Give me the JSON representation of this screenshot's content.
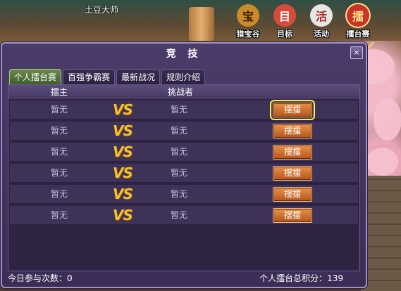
{
  "player": {
    "name": "土豆大师"
  },
  "top_icons": [
    {
      "label": "猎宝谷",
      "icon": "treasure-icon",
      "glyph": "宝",
      "color": "#c98a2a"
    },
    {
      "label": "目标",
      "icon": "target-character-icon",
      "glyph": "目",
      "color": "#d84a3a"
    },
    {
      "label": "活动",
      "icon": "event-icon",
      "glyph": "活",
      "color": "#e6e6e6"
    },
    {
      "label": "擂台赛",
      "icon": "arena-icon",
      "glyph": "擂",
      "color": "#c8332a"
    }
  ],
  "dialog": {
    "title": "竞 技",
    "close": "×",
    "tabs": [
      "个人擂台赛",
      "百强争霸赛",
      "最新战况",
      "规则介绍"
    ],
    "active_tab": 0,
    "columns": {
      "host": "擂主",
      "challenger": "挑战者"
    },
    "rows": [
      {
        "host": "暂无",
        "vs": "VS",
        "challenger": "暂无",
        "action": "摆擂"
      },
      {
        "host": "暂无",
        "vs": "VS",
        "challenger": "暂无",
        "action": "摆擂"
      },
      {
        "host": "暂无",
        "vs": "VS",
        "challenger": "暂无",
        "action": "摆擂"
      },
      {
        "host": "暂无",
        "vs": "VS",
        "challenger": "暂无",
        "action": "摆擂"
      },
      {
        "host": "暂无",
        "vs": "VS",
        "challenger": "暂无",
        "action": "摆擂"
      },
      {
        "host": "暂无",
        "vs": "VS",
        "challenger": "暂无",
        "action": "摆擂"
      }
    ],
    "footer_left": "今日参与次数：0",
    "footer_right": "个人擂台总积分：139"
  }
}
